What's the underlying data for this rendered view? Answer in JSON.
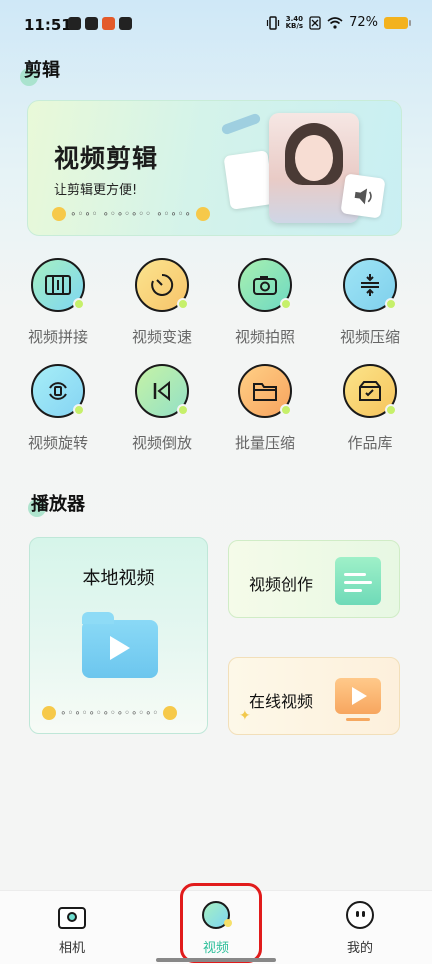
{
  "status_bar": {
    "time": "11:51",
    "net_speed_top": "3.40",
    "net_speed_bottom": "KB/s",
    "battery": "72%"
  },
  "edit_section": {
    "title": "剪辑",
    "banner": {
      "title": "视频剪辑",
      "subtitle": "让剪辑更方便!"
    },
    "tools": [
      {
        "label": "视频拼接",
        "icon": "film-strip-icon"
      },
      {
        "label": "视频变速",
        "icon": "speed-dial-icon"
      },
      {
        "label": "视频拍照",
        "icon": "camera-icon"
      },
      {
        "label": "视频压缩",
        "icon": "compress-icon"
      },
      {
        "label": "视频旋转",
        "icon": "rotate-icon"
      },
      {
        "label": "视频倒放",
        "icon": "rewind-icon"
      },
      {
        "label": "批量压缩",
        "icon": "folder-icon"
      },
      {
        "label": "作品库",
        "icon": "archive-box-icon"
      }
    ]
  },
  "player_section": {
    "title": "播放器",
    "local_video": "本地视频",
    "video_create": "视频创作",
    "online_video": "在线视频"
  },
  "bottom_nav": {
    "items": [
      {
        "label": "相机",
        "icon": "camera-icon"
      },
      {
        "label": "视频",
        "icon": "video-icon",
        "active": true
      },
      {
        "label": "我的",
        "icon": "profile-face-icon"
      }
    ],
    "active_color": "#2cbf9a"
  },
  "colors": {
    "highlight_ring": "#e11b1b"
  }
}
